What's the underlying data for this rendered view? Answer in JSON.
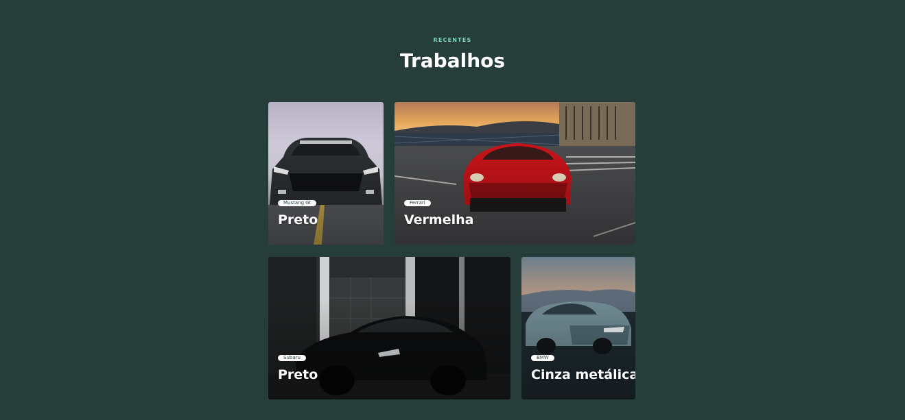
{
  "section": {
    "eyebrow": "RECENTES",
    "title": "Trabalhos"
  },
  "cards": [
    {
      "tag": "Mustang Gt",
      "title": "Preto",
      "car_color": "#2c2f33",
      "sky_color": "#cfc8d8"
    },
    {
      "tag": "Ferrari",
      "title": "Vermelha",
      "car_color": "#c8141a",
      "sky_color": "#e6a85c"
    },
    {
      "tag": "Subaru",
      "title": "Preto",
      "car_color": "#0c0d0e",
      "sky_color": "#2a2c2d"
    },
    {
      "tag": "BMW",
      "title": "Cinza metálica",
      "car_color": "#6f8a93",
      "sky_color": "#d6a07a"
    }
  ],
  "colors": {
    "background": "#263d3a",
    "accent": "#7fd6bd",
    "text": "#ffffff"
  }
}
